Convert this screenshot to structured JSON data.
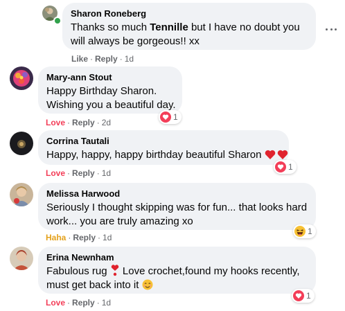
{
  "comments": [
    {
      "author": "Sharon Roneberg",
      "text_parts": [
        "Thanks so much ",
        "Tennille",
        " but I have no doubt you will always be gorgeous!! xx"
      ],
      "action_react": "Like",
      "action_reply": "Reply",
      "time": "1d",
      "online": true
    },
    {
      "author": "Mary-ann Stout",
      "text": "Happy Birthday Sharon. Wishing you a beautiful day.",
      "action_react": "Love",
      "action_reply": "Reply",
      "time": "2d",
      "reaction_count": "1",
      "reaction_icon": "love-reaction-icon"
    },
    {
      "author": "Corrina Tautali",
      "text": "Happy, happy, happy birthday beautiful Sharon",
      "action_react": "Love",
      "action_reply": "Reply",
      "time": "1d",
      "reaction_count": "1",
      "reaction_icon": "love-reaction-icon"
    },
    {
      "author": "Melissa Harwood",
      "text": "Seriously I thought skipping was for fun... that looks hard work... you are truly amazing xo",
      "action_react": "Haha",
      "action_reply": "Reply",
      "time": "1d",
      "reaction_count": "1",
      "reaction_icon": "haha-reaction-icon"
    },
    {
      "author": "Erina Newnham",
      "text_parts": [
        "Fabulous rug ",
        " Love crochet,found my hooks recently, must get back into it "
      ],
      "action_react": "Love",
      "action_reply": "Reply",
      "time": "1d",
      "reaction_count": "1",
      "reaction_icon": "love-reaction-icon"
    }
  ],
  "separator": "·",
  "colors": {
    "bubble": "#f0f2f5",
    "meta": "#65676b",
    "love": "#f33e58",
    "haha": "#e4a11b",
    "online": "#31a24c"
  }
}
